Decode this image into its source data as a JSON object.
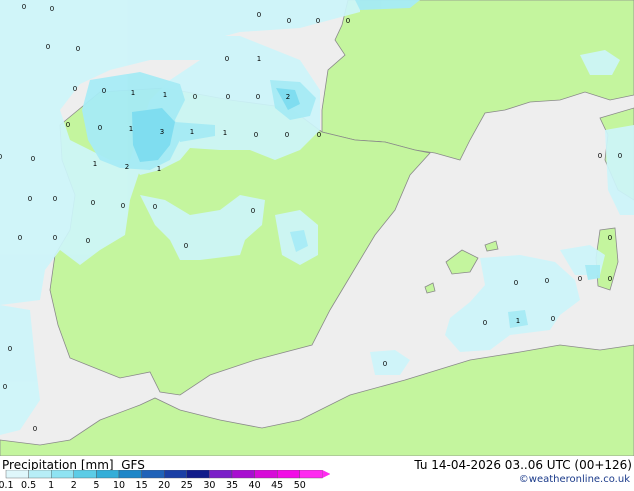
{
  "title": "Precipitation [mm]",
  "model": "GFS",
  "valid_time": "Tu 14-04-2026 03..06 UTC (00+126)",
  "credit": "©weatheronline.co.uk",
  "colors": {
    "sea": "#eeeeee",
    "land": "#c4f59e",
    "precip_light": "#cdf5fa",
    "precip_mid": "#a6ebf5",
    "precip_heavy": "#7cdcef",
    "coastline": "#8a8a8a"
  },
  "legend": {
    "levels": [
      "0.1",
      "0.5",
      "1",
      "2",
      "5",
      "10",
      "15",
      "20",
      "25",
      "30",
      "35",
      "40",
      "45",
      "50"
    ],
    "colors": [
      "#dff7fb",
      "#b7eef7",
      "#8fe3f2",
      "#5ccce6",
      "#34aed8",
      "#1d86c8",
      "#1f62b8",
      "#1a3fa5",
      "#111c8a",
      "#7a1fc8",
      "#a80fd0",
      "#d70bd8",
      "#f20ce6",
      "#ff2bf0"
    ]
  },
  "markers": [
    {
      "text": "0"
    },
    {
      "text": "0"
    },
    {
      "text": "0"
    },
    {
      "text": "0"
    },
    {
      "text": "0"
    },
    {
      "text": "0"
    },
    {
      "text": "0"
    },
    {
      "text": "0"
    },
    {
      "text": "1"
    },
    {
      "text": "0"
    },
    {
      "text": "0"
    },
    {
      "text": "0"
    },
    {
      "text": "1"
    },
    {
      "text": "1"
    },
    {
      "text": "0"
    },
    {
      "text": "0"
    },
    {
      "text": "0"
    },
    {
      "text": "2"
    },
    {
      "text": "0"
    },
    {
      "text": "0"
    },
    {
      "text": "1"
    },
    {
      "text": "3"
    },
    {
      "text": "1"
    },
    {
      "text": "1"
    },
    {
      "text": "0"
    },
    {
      "text": "0"
    },
    {
      "text": "0"
    },
    {
      "text": "0"
    },
    {
      "text": "0"
    },
    {
      "text": "1"
    },
    {
      "text": "2"
    },
    {
      "text": "1"
    },
    {
      "text": "0"
    },
    {
      "text": "0"
    },
    {
      "text": "0"
    },
    {
      "text": "0"
    },
    {
      "text": "0"
    },
    {
      "text": "0"
    },
    {
      "text": "0"
    },
    {
      "text": "0"
    },
    {
      "text": "0"
    },
    {
      "text": "0"
    },
    {
      "text": "0"
    },
    {
      "text": "0"
    },
    {
      "text": "0"
    },
    {
      "text": "0"
    },
    {
      "text": "0"
    },
    {
      "text": "0"
    },
    {
      "text": "1"
    },
    {
      "text": "0"
    },
    {
      "text": "0"
    },
    {
      "text": "0"
    },
    {
      "text": "0"
    },
    {
      "text": "0"
    },
    {
      "text": "0"
    },
    {
      "text": "0"
    }
  ]
}
